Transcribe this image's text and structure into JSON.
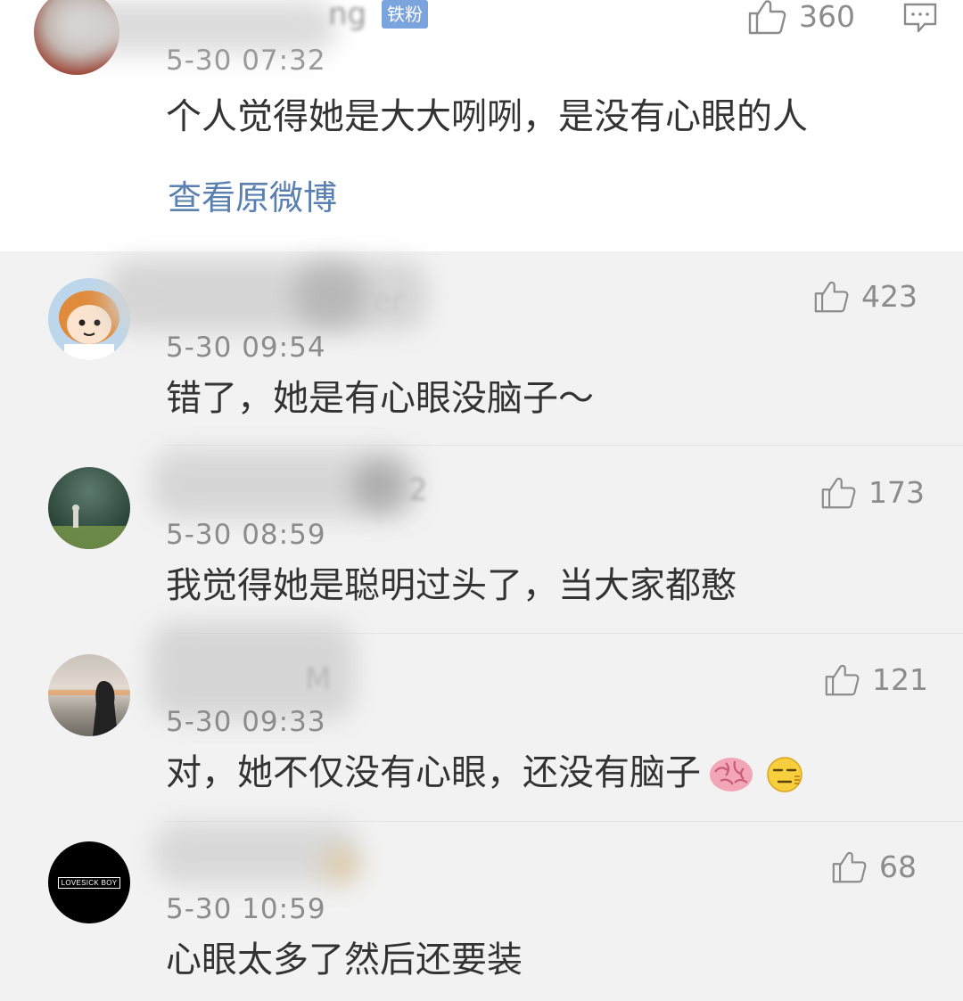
{
  "main_comment": {
    "nickname_visible": "ng",
    "badge": "铁粉",
    "time": "5-30 07:32",
    "text": "个人觉得她是大大咧咧，是没有心眼的人",
    "likes": "360",
    "view_original": "查看原微博"
  },
  "replies": [
    {
      "nickname_visible": "er",
      "time": "5-30 09:54",
      "text": "错了，她是有心眼没脑子～",
      "likes": "423"
    },
    {
      "nickname_visible": "2",
      "time": "5-30 08:59",
      "text": "我觉得她是聪明过头了，当大家都憨",
      "likes": "173"
    },
    {
      "nickname_visible": "M",
      "time": "5-30 09:33",
      "text": "对，她不仅没有心眼，还没有脑子",
      "likes": "121"
    },
    {
      "nickname_visible": "",
      "avatar_text": "LOVESICK BOY",
      "time": "5-30 10:59",
      "text": "心眼太多了然后还要装",
      "likes": "68"
    }
  ],
  "icons": {
    "like": "thumbs-up-icon",
    "reply": "comment-icon",
    "brain": "brain-emoji",
    "smirk": "smirk-emoji"
  },
  "colors": {
    "link": "#5a80b2",
    "badge": "#7ba3de",
    "meta_text": "#8c8c8c",
    "body_text": "#333333",
    "reply_bg": "#f2f2f2"
  }
}
